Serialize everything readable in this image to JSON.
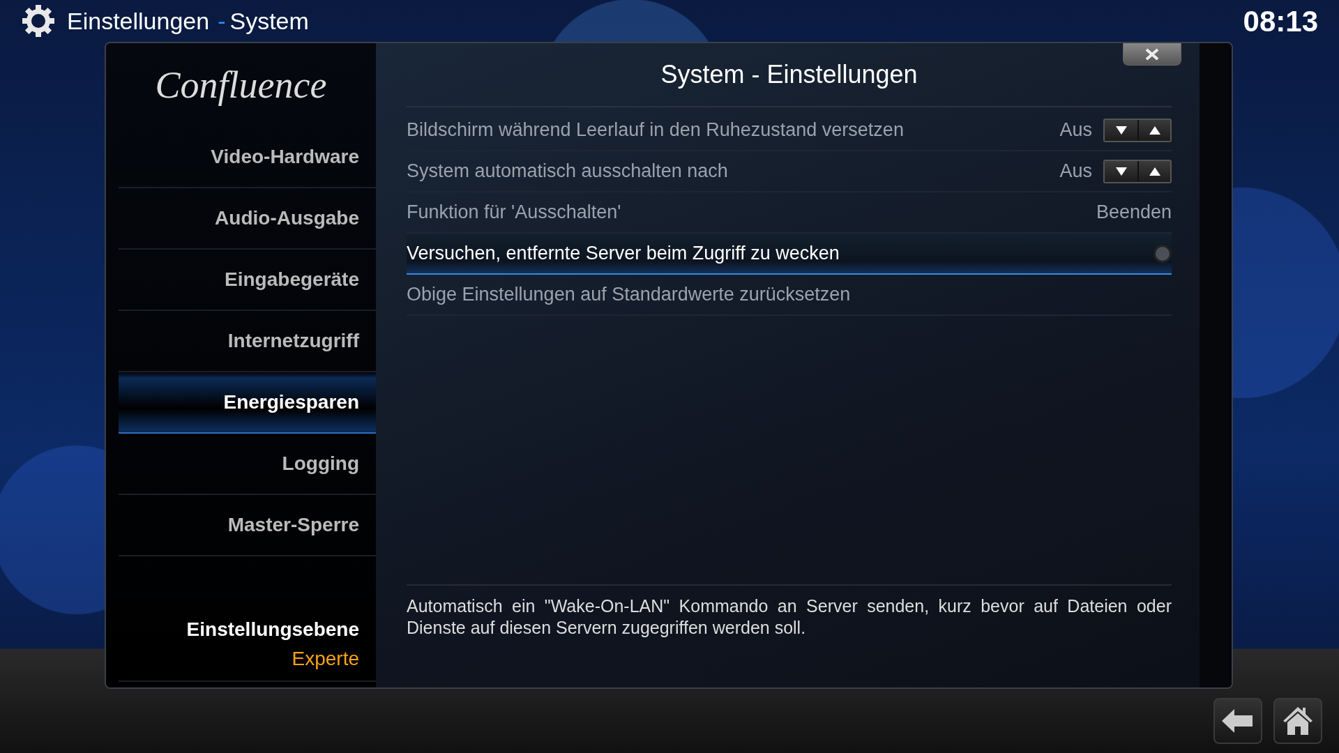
{
  "header": {
    "title": "Einstellungen",
    "separator": "-",
    "subtitle": "System",
    "clock": "08:13"
  },
  "sidebar": {
    "logo": "Confluence",
    "items": [
      {
        "label": "Video-Hardware",
        "selected": false
      },
      {
        "label": "Audio-Ausgabe",
        "selected": false
      },
      {
        "label": "Eingabegeräte",
        "selected": false
      },
      {
        "label": "Internetzugriff",
        "selected": false
      },
      {
        "label": "Energiesparen",
        "selected": true
      },
      {
        "label": "Logging",
        "selected": false
      },
      {
        "label": "Master-Sperre",
        "selected": false
      }
    ],
    "level_label": "Einstellungsebene",
    "level_value": "Experte"
  },
  "dialog": {
    "title": "System - Einstellungen",
    "settings": [
      {
        "kind": "spinner",
        "label": "Bildschirm während Leerlauf in den Ruhezustand versetzen",
        "value": "Aus",
        "selected": false
      },
      {
        "kind": "spinner",
        "label": "System automatisch ausschalten nach",
        "value": "Aus",
        "selected": false
      },
      {
        "kind": "value",
        "label": "Funktion für 'Ausschalten'",
        "value": "Beenden",
        "selected": false
      },
      {
        "kind": "toggle",
        "label": "Versuchen, entfernte Server beim Zugriff zu wecken",
        "on": false,
        "selected": true
      },
      {
        "kind": "action",
        "label": "Obige Einstellungen auf Standardwerte zurücksetzen",
        "selected": false
      }
    ],
    "description": "Automatisch ein \"Wake-On-LAN\" Kommando an Server senden, kurz bevor auf Dateien oder Dienste auf diesen Servern zugegriffen werden soll."
  }
}
